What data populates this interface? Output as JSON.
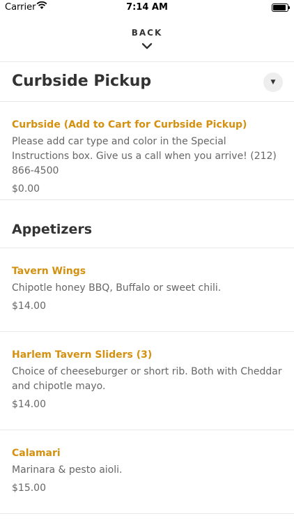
{
  "status": {
    "carrier": "Carrier",
    "time": "7:14 AM"
  },
  "nav": {
    "back_label": "BACK"
  },
  "section": {
    "title": "Curbside Pickup"
  },
  "curbside_item": {
    "name": "Curbside (Add to Cart for Curbside Pickup)",
    "description": "Please add car type and color in the Special Instructions box. Give us a call when you arrive! (212) 866-4500",
    "price": "$0.00"
  },
  "category": {
    "title": "Appetizers"
  },
  "items": [
    {
      "name": "Tavern Wings",
      "description": "Chipotle honey BBQ, Buffalo or sweet chili.",
      "price": "$14.00"
    },
    {
      "name": "Harlem Tavern Sliders (3)",
      "description": "Choice of cheeseburger or short rib. Both with Cheddar and chipotle mayo.",
      "price": "$14.00"
    },
    {
      "name": "Calamari",
      "description": "Marinara & pesto aioli.",
      "price": "$15.00"
    }
  ],
  "colors": {
    "accent": "#d4900f",
    "text": "#333333",
    "muted": "#666666",
    "divider": "#e8e8e8"
  },
  "icons": {
    "wifi": "wifi-icon",
    "battery": "battery-icon",
    "chevron": "chevron-down-icon",
    "dropdown": "triangle-down-icon"
  }
}
